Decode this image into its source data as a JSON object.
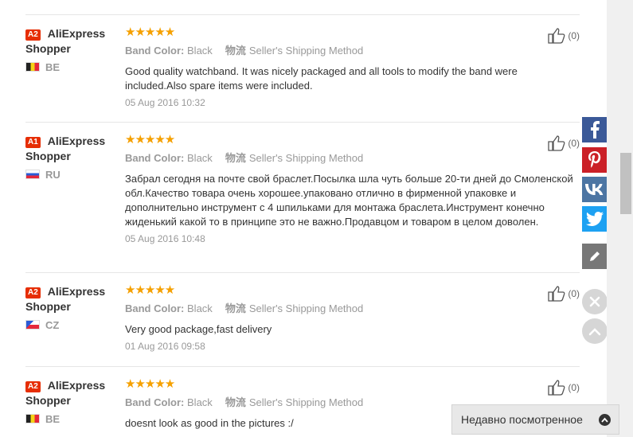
{
  "reviews": [
    {
      "level": "A2",
      "name_line1": "AliExpress",
      "name_line2": "Shopper",
      "country": "BE",
      "stars": "★★★★★",
      "attr_label": "Band Color:",
      "attr_value": "Black",
      "ship_label": "物流",
      "ship_value": "Seller's Shipping Method",
      "text": "Good quality watchband. It was nicely packaged and all tools to modify the band were included.Also spare items were included.",
      "date": "05 Aug 2016 10:32",
      "helpful": "(0)"
    },
    {
      "level": "A1",
      "name_line1": "AliExpress",
      "name_line2": "Shopper",
      "country": "RU",
      "stars": "★★★★★",
      "attr_label": "Band Color:",
      "attr_value": "Black",
      "ship_label": "物流",
      "ship_value": "Seller's Shipping Method",
      "text": "Забрал сегодня на почте свой браслет.Посылка шла чуть больше 20-ти дней до Смоленской обл.Качество товара очень хорошее.упаковано отлично в фирменной упаковке и дополнительно инструмент с 4 шпильками для монтажа браслета.Инструмент конечно жиденький какой то в принципе это не важно.Продавцом и товаром в целом доволен.",
      "date": "05 Aug 2016 10:48",
      "helpful": "(0)"
    },
    {
      "level": "A2",
      "name_line1": "AliExpress",
      "name_line2": "Shopper",
      "country": "CZ",
      "stars": "★★★★★",
      "attr_label": "Band Color:",
      "attr_value": "Black",
      "ship_label": "物流",
      "ship_value": "Seller's Shipping Method",
      "text": "Very good package,fast delivery",
      "date": "01 Aug 2016 09:58",
      "helpful": "(0)"
    },
    {
      "level": "A2",
      "name_line1": "AliExpress",
      "name_line2": "Shopper",
      "country": "BE",
      "stars": "★★★★★",
      "attr_label": "Band Color:",
      "attr_value": "Black",
      "ship_label": "物流",
      "ship_value": "Seller's Shipping Method",
      "text": "doesnt look as good in the pictures :/",
      "date": "",
      "helpful": "(0)"
    }
  ],
  "recently_viewed": {
    "label": "Недавно посмотренное"
  },
  "icons": {
    "helpful": "thumbs-up-icon",
    "facebook": "facebook-icon",
    "pinterest": "pinterest-icon",
    "vk": "vk-icon",
    "twitter": "twitter-icon",
    "edit": "pencil-icon",
    "close": "close-icon",
    "up": "chevron-up-icon"
  },
  "colors": {
    "stars": "#f5a000",
    "badge": "#e62e04",
    "facebook": "#3b5998",
    "pinterest": "#cb2027",
    "vk": "#4c75a3",
    "twitter": "#1da1f2"
  }
}
